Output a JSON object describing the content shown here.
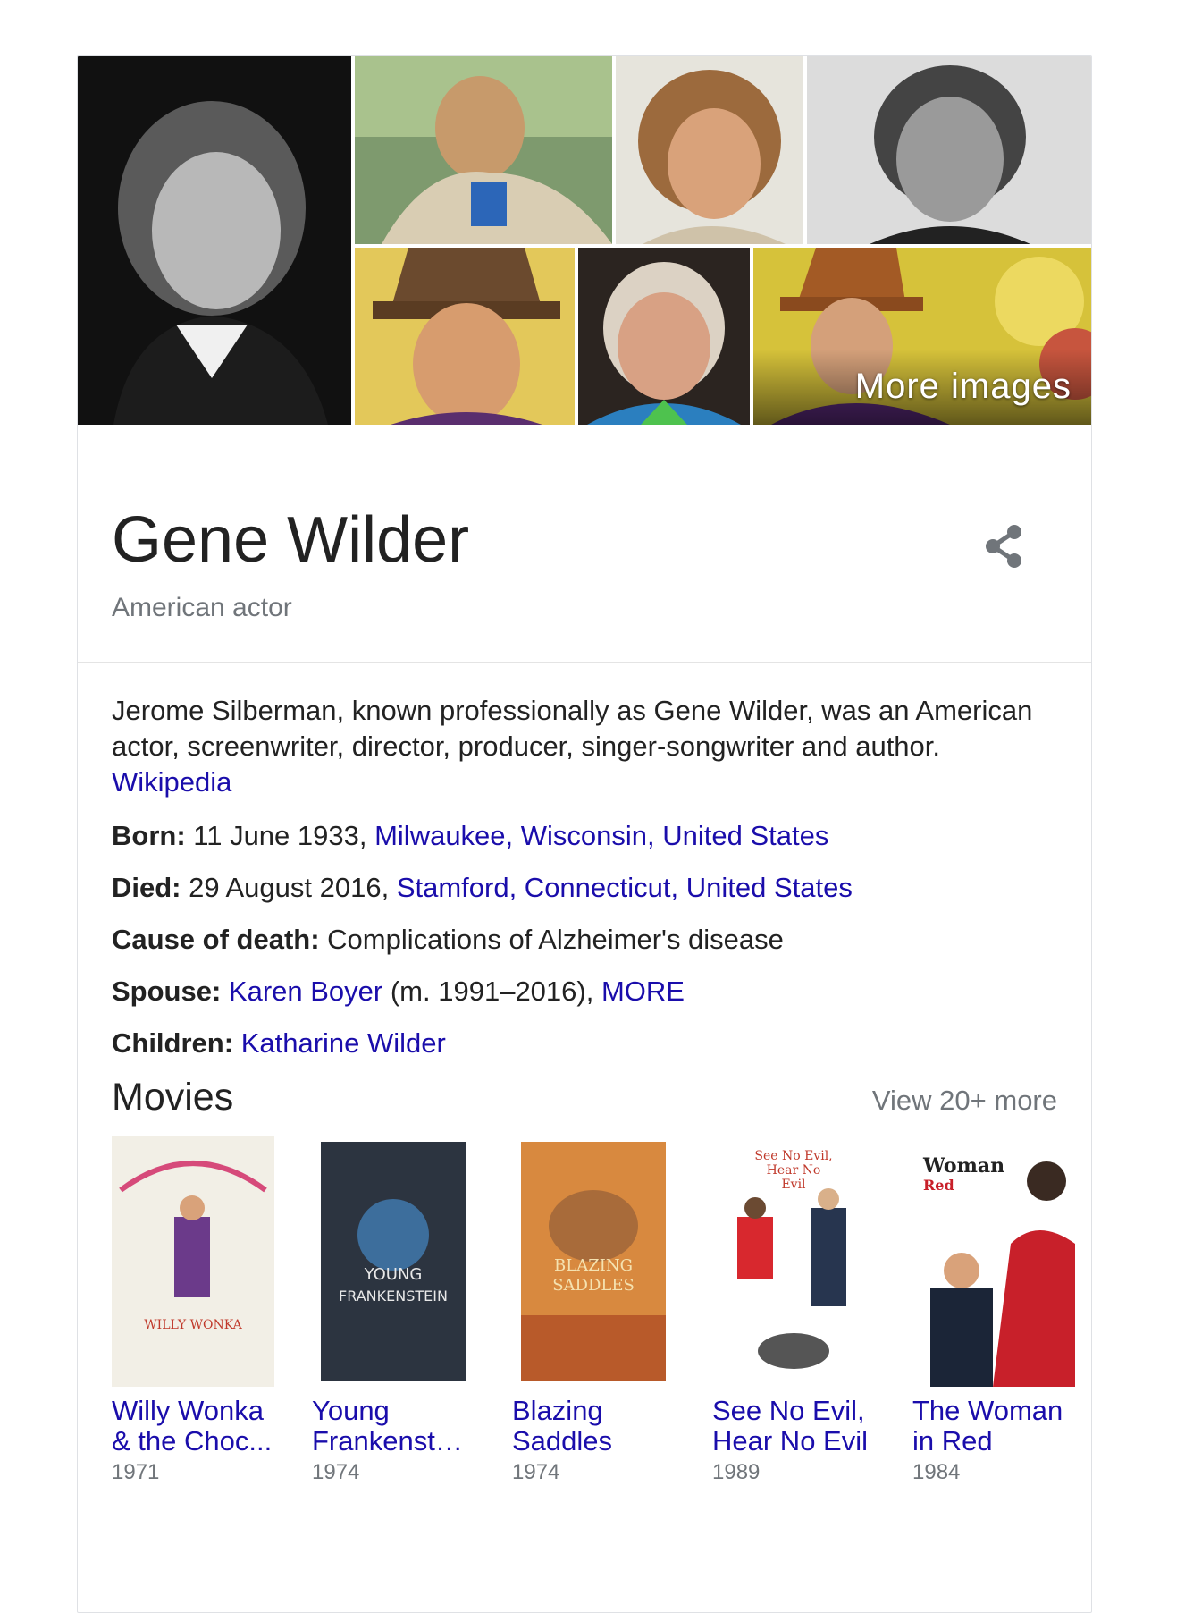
{
  "images": {
    "more_label": "More images"
  },
  "entity": {
    "name": "Gene Wilder",
    "subtitle": "American actor"
  },
  "description": {
    "text": "Jerome Silberman, known professionally as Gene Wilder, was an American actor, screenwriter, director, producer, singer-songwriter and author.",
    "source": "Wikipedia"
  },
  "facts": {
    "born": {
      "label": "Born:",
      "value": " 11 June 1933, ",
      "link": "Milwaukee, Wisconsin, United States"
    },
    "died": {
      "label": "Died:",
      "value": " 29 August 2016, ",
      "link": "Stamford, Connecticut, United States"
    },
    "cause": {
      "label": "Cause of death:",
      "value": " Complications of Alzheimer's disease"
    },
    "spouse": {
      "label": "Spouse:",
      "link": "Karen Boyer",
      "value": " (m. 1991–2016), ",
      "more": "MORE"
    },
    "children": {
      "label": "Children:",
      "link": "Katharine Wilder"
    }
  },
  "movies": {
    "title": "Movies",
    "view_more": "View 20+ more",
    "items": [
      {
        "title": "Willy Wonka & the Choc...",
        "year": "1971",
        "color": "#f2efe6"
      },
      {
        "title": "Young Frankenst…",
        "year": "1974",
        "color": "#2c3440"
      },
      {
        "title": "Blazing Saddles",
        "year": "1974",
        "color": "#d8893f"
      },
      {
        "title": "See No Evil, Hear No Evil",
        "year": "1989",
        "color": "#ffffff"
      },
      {
        "title": "The Woman in Red",
        "year": "1984",
        "color": "#c8202a"
      }
    ]
  },
  "colors": {
    "link": "#1a0dab",
    "secondary_text": "#70757a",
    "border": "#dfe1e5"
  }
}
